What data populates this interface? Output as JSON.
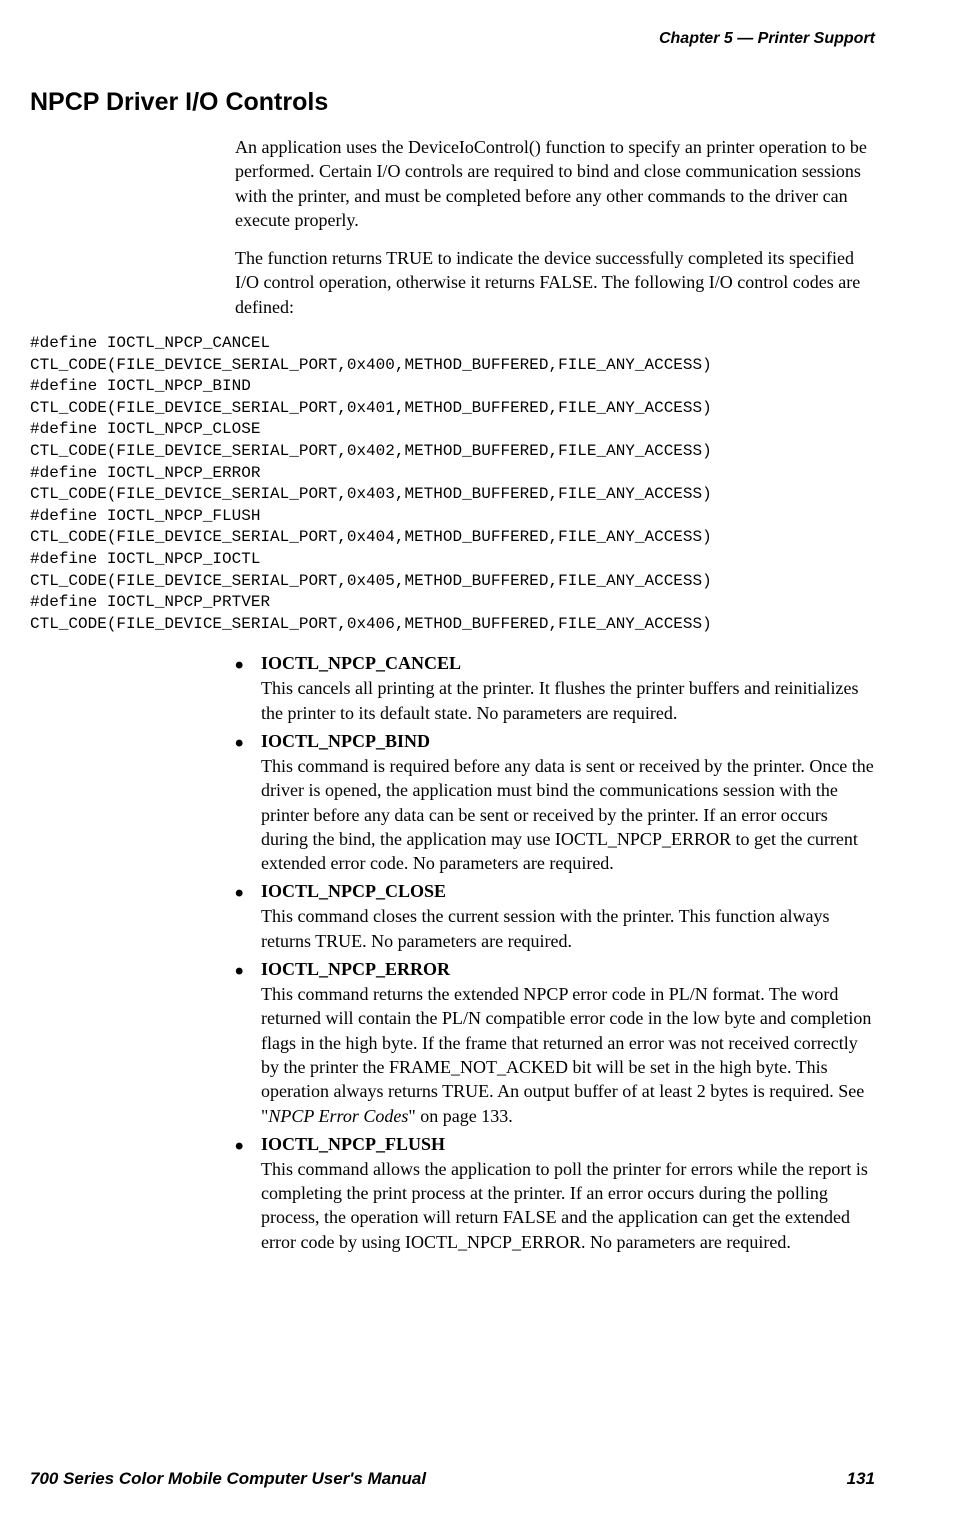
{
  "header": {
    "chapter_num": "Chapter  5",
    "em_dash": "  —  ",
    "chapter_title": "Printer Support"
  },
  "section_heading": "NPCP Driver I/O Controls",
  "para1": "An application uses the DeviceIoControl() function to specify an printer operation to be performed. Certain I/O controls are required to bind and close communication sessions with the printer, and must be completed before any other commands to the driver can execute properly.",
  "para2": "The function returns TRUE to indicate the device successfully completed its specified I/O control operation, otherwise it returns FALSE. The following I/O control codes are defined:",
  "code_block": "#define IOCTL_NPCP_CANCEL\nCTL_CODE(FILE_DEVICE_SERIAL_PORT,0x400,METHOD_BUFFERED,FILE_ANY_ACCESS)\n#define IOCTL_NPCP_BIND\nCTL_CODE(FILE_DEVICE_SERIAL_PORT,0x401,METHOD_BUFFERED,FILE_ANY_ACCESS)\n#define IOCTL_NPCP_CLOSE\nCTL_CODE(FILE_DEVICE_SERIAL_PORT,0x402,METHOD_BUFFERED,FILE_ANY_ACCESS)\n#define IOCTL_NPCP_ERROR\nCTL_CODE(FILE_DEVICE_SERIAL_PORT,0x403,METHOD_BUFFERED,FILE_ANY_ACCESS)\n#define IOCTL_NPCP_FLUSH\nCTL_CODE(FILE_DEVICE_SERIAL_PORT,0x404,METHOD_BUFFERED,FILE_ANY_ACCESS)\n#define IOCTL_NPCP_IOCTL\nCTL_CODE(FILE_DEVICE_SERIAL_PORT,0x405,METHOD_BUFFERED,FILE_ANY_ACCESS)\n#define IOCTL_NPCP_PRTVER\nCTL_CODE(FILE_DEVICE_SERIAL_PORT,0x406,METHOD_BUFFERED,FILE_ANY_ACCESS)",
  "ioctls": [
    {
      "name": "IOCTL_NPCP_CANCEL",
      "desc": "This cancels all printing at the printer. It flushes the printer buffers and reinitializes the printer to its default state. No parameters are required."
    },
    {
      "name": "IOCTL_NPCP_BIND",
      "desc": "This command is required before any data is sent or received by the printer. Once the driver is opened, the application must bind the communications session with the printer before any data can be sent or received by the printer. If an error occurs during the bind, the application may use IOCTL_NPCP_ERROR to get the current extended error code. No parameters are required."
    },
    {
      "name": "IOCTL_NPCP_CLOSE",
      "desc": "This command closes the current session with the printer. This function always returns TRUE. No parameters are required."
    },
    {
      "name": "IOCTL_NPCP_ERROR",
      "desc_pre": "This command returns the extended NPCP error code in PL/N format. The word returned will contain the PL/N compatible error code in the low byte and completion flags in the high byte. If the frame that returned an error was not received correctly by the printer the FRAME_NOT_ACKED bit will be set in the high byte. This operation always returns TRUE. An output buffer of at least 2 bytes is required. See \"",
      "desc_italic": "NPCP Error Codes",
      "desc_post": "\" on page 133."
    },
    {
      "name": "IOCTL_NPCP_FLUSH",
      "desc": "This command allows the application to poll the printer for errors while the report is completing the print process at the printer. If an error occurs during the polling process, the operation will return FALSE and the application can get the extended error code by using IOCTL_NPCP_ERROR. No parameters are required."
    }
  ],
  "footer": {
    "manual_title": "700 Series Color Mobile Computer User's Manual",
    "page_number": "131"
  }
}
